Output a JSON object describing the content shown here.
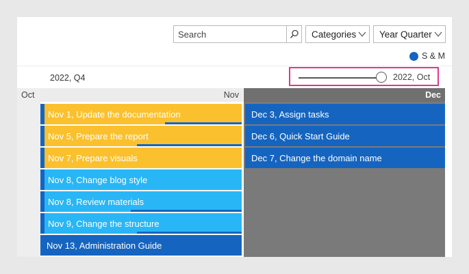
{
  "toolbar": {
    "search_placeholder": "Search",
    "categories_label": "Categories",
    "year_quarter_label": "Year Quarter"
  },
  "legend": {
    "label": "S & M",
    "color": "#1565c0"
  },
  "period": {
    "label": "2022, Q4"
  },
  "slider": {
    "value_label": "2022, Oct",
    "level": 1.0
  },
  "months": {
    "oct": "Oct",
    "nov": "Nov",
    "dec": "Dec"
  },
  "colors": {
    "orange": "#fbc02d",
    "cyan": "#29b6f6",
    "blue": "#1565c0",
    "highlight": "#e0358f"
  },
  "november_tasks": [
    {
      "label": "Nov 1, Update the documentation",
      "color": "orange"
    },
    {
      "label": "Nov 5, Prepare the report",
      "color": "orange"
    },
    {
      "label": "Nov 7, Prepare visuals",
      "color": "orange"
    },
    {
      "label": "Nov 8, Change blog style",
      "color": "cyan"
    },
    {
      "label": "Nov 8, Review materials",
      "color": "cyan"
    },
    {
      "label": "Nov 9, Change the structure",
      "color": "cyan"
    },
    {
      "label": "Nov 13, Administration Guide",
      "color": "blue"
    }
  ],
  "december_tasks": [
    {
      "label": "Dec 3, Assign tasks",
      "color": "blue"
    },
    {
      "label": "Dec 6, Quick Start Guide",
      "color": "blue"
    },
    {
      "label": "Dec 7, Change the domain name",
      "color": "blue"
    }
  ]
}
